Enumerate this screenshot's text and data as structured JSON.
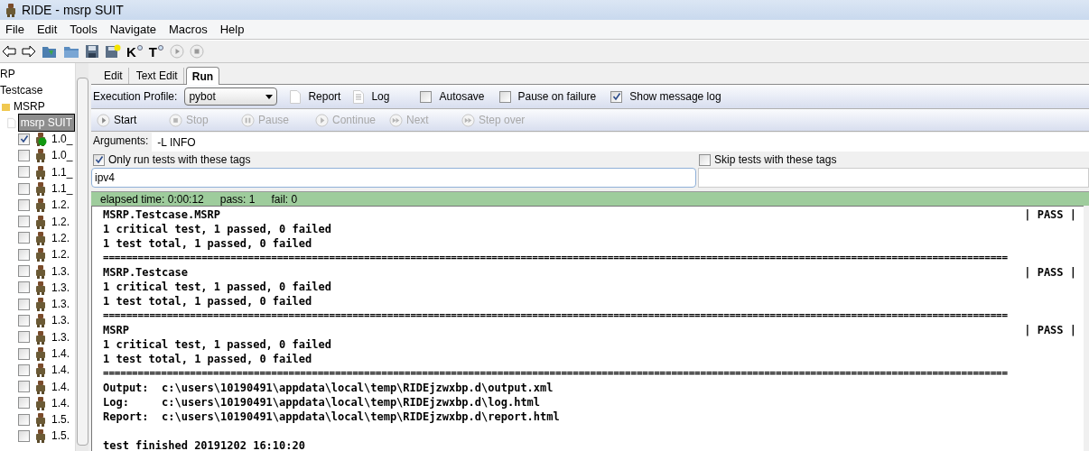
{
  "window": {
    "title": "RIDE - msrp SUIT"
  },
  "menu": [
    "File",
    "Edit",
    "Tools",
    "Navigate",
    "Macros",
    "Help"
  ],
  "toolbar": [
    {
      "kind": "back"
    },
    {
      "kind": "forward"
    },
    {
      "kind": "open-dir"
    },
    {
      "kind": "folder"
    },
    {
      "kind": "save"
    },
    {
      "kind": "save-all"
    },
    {
      "kind": "K"
    },
    {
      "kind": "T"
    },
    {
      "kind": "play"
    },
    {
      "kind": "stop"
    }
  ],
  "toolbar_letters": {
    "K": "K",
    "T": "T"
  },
  "tree": {
    "items": [
      {
        "kind": "text",
        "label": "RP"
      },
      {
        "kind": "text",
        "label": "Testcase"
      },
      {
        "kind": "folder",
        "label": "MSRP"
      },
      {
        "kind": "suite",
        "label": "msrp SUIT",
        "selected": true
      },
      {
        "kind": "test",
        "label": "1.0_",
        "checked": true,
        "passed": true
      },
      {
        "kind": "test",
        "label": "1.0_",
        "checked": false,
        "passed": false
      },
      {
        "kind": "test",
        "label": "1.1_",
        "checked": false,
        "passed": false
      },
      {
        "kind": "test",
        "label": "1.1_",
        "checked": false,
        "passed": false
      },
      {
        "kind": "test",
        "label": "1.2.",
        "checked": false,
        "passed": false
      },
      {
        "kind": "test",
        "label": "1.2.",
        "checked": false,
        "passed": false
      },
      {
        "kind": "test",
        "label": "1.2.",
        "checked": false,
        "passed": false
      },
      {
        "kind": "test",
        "label": "1.2.",
        "checked": false,
        "passed": false
      },
      {
        "kind": "test",
        "label": "1.3.",
        "checked": false,
        "passed": false
      },
      {
        "kind": "test",
        "label": "1.3.",
        "checked": false,
        "passed": false
      },
      {
        "kind": "test",
        "label": "1.3.",
        "checked": false,
        "passed": false
      },
      {
        "kind": "test",
        "label": "1.3.",
        "checked": false,
        "passed": false
      },
      {
        "kind": "test",
        "label": "1.3.",
        "checked": false,
        "passed": false
      },
      {
        "kind": "test",
        "label": "1.4.",
        "checked": false,
        "passed": false
      },
      {
        "kind": "test",
        "label": "1.4.",
        "checked": false,
        "passed": false
      },
      {
        "kind": "test",
        "label": "1.4.",
        "checked": false,
        "passed": false
      },
      {
        "kind": "test",
        "label": "1.4.",
        "checked": false,
        "passed": false
      },
      {
        "kind": "test",
        "label": "1.5.",
        "checked": false,
        "passed": false
      },
      {
        "kind": "test",
        "label": "1.5.",
        "checked": false,
        "passed": false
      }
    ]
  },
  "tabs": [
    {
      "label": "Edit",
      "selected": false
    },
    {
      "label": "Text Edit",
      "selected": false
    },
    {
      "label": "Run",
      "selected": true
    }
  ],
  "profile": {
    "label": "Execution Profile:",
    "value": "pybot"
  },
  "links": [
    {
      "kind": "report",
      "label": "Report"
    },
    {
      "kind": "log",
      "label": "Log"
    }
  ],
  "options": [
    {
      "label": "Autosave",
      "checked": false
    },
    {
      "label": "Pause on failure",
      "checked": false
    },
    {
      "label": "Show message log",
      "checked": true
    }
  ],
  "run_buttons": [
    {
      "label": "Start",
      "disabled": false,
      "kind": "play"
    },
    {
      "label": "Stop",
      "disabled": true,
      "kind": "stop"
    },
    {
      "label": "Pause",
      "disabled": true,
      "kind": "pause"
    },
    {
      "label": "Continue",
      "disabled": true,
      "kind": "play"
    },
    {
      "label": "Next",
      "disabled": true,
      "kind": "ff"
    },
    {
      "label": "Step over",
      "disabled": true,
      "kind": "ff"
    }
  ],
  "arguments": {
    "label": "Arguments:",
    "value": "-L INFO"
  },
  "include_tags": {
    "label": "Only run tests with these tags",
    "checked": true,
    "value": "ipv4"
  },
  "exclude_tags": {
    "label": "Skip tests with these tags",
    "checked": false
  },
  "status": {
    "elapsed": "elapsed time: 0:00:12",
    "pass": "pass: 1",
    "fail": "fail: 0",
    "passed": true
  },
  "log": [
    {
      "kind": "header",
      "text": "MSRP.Testcase.MSRP",
      "status": "| PASS |"
    },
    {
      "kind": "line",
      "text": "1 critical test, 1 passed, 0 failed"
    },
    {
      "kind": "line",
      "text": "1 test total, 1 passed, 0 failed"
    },
    {
      "kind": "separator",
      "text": "============================================================================================================================================================"
    },
    {
      "kind": "header",
      "text": "MSRP.Testcase",
      "status": "| PASS |"
    },
    {
      "kind": "line",
      "text": "1 critical test, 1 passed, 0 failed"
    },
    {
      "kind": "line",
      "text": "1 test total, 1 passed, 0 failed"
    },
    {
      "kind": "separator",
      "text": "============================================================================================================================================================"
    },
    {
      "kind": "header",
      "text": "MSRP",
      "status": "| PASS |"
    },
    {
      "kind": "line",
      "text": "1 critical test, 1 passed, 0 failed"
    },
    {
      "kind": "line",
      "text": "1 test total, 1 passed, 0 failed"
    },
    {
      "kind": "separator",
      "text": "============================================================================================================================================================"
    },
    {
      "kind": "line",
      "text": "Output:  c:\\users\\10190491\\appdata\\local\\temp\\RIDEjzwxbp.d\\output.xml"
    },
    {
      "kind": "line",
      "text": "Log:     c:\\users\\10190491\\appdata\\local\\temp\\RIDEjzwxbp.d\\log.html"
    },
    {
      "kind": "line",
      "text": "Report:  c:\\users\\10190491\\appdata\\local\\temp\\RIDEjzwxbp.d\\report.html"
    },
    {
      "kind": "blank"
    },
    {
      "kind": "line",
      "text": "test finished 20191202 16:10:20"
    }
  ]
}
